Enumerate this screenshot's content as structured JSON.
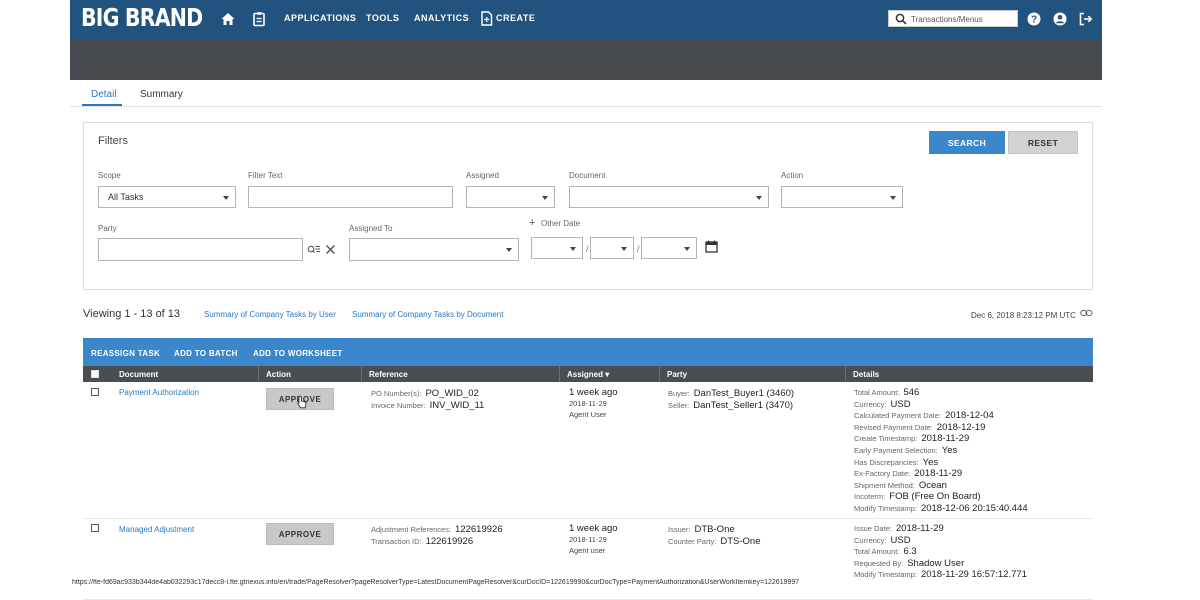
{
  "nav": {
    "brand": "BIG BRAND",
    "links": [
      "APPLICATIONS",
      "TOOLS",
      "ANALYTICS",
      "CREATE"
    ],
    "search_placeholder": "Transactions/Menus"
  },
  "tabs": [
    "Detail",
    "Summary"
  ],
  "filters": {
    "title": "Filters",
    "search_label": "SEARCH",
    "reset_label": "RESET",
    "scope_label": "Scope",
    "scope_value": "All Tasks",
    "filter_text_label": "Filter Text",
    "assigned_label": "Assigned",
    "document_label": "Document",
    "action_label": "Action",
    "party_label": "Party",
    "assigned_to_label": "Assigned To",
    "other_date_label": "Other Date"
  },
  "viewing": {
    "text": "Viewing 1 - 13 of 13",
    "link_by_user": "Summary of Company Tasks by User",
    "link_by_document": "Summary of Company Tasks by Document",
    "timestamp": "Dec 6, 2018 8:23:12 PM UTC"
  },
  "actions": [
    "REASSIGN TASK",
    "ADD TO BATCH",
    "ADD TO WORKSHEET"
  ],
  "table": {
    "headers": [
      "Document",
      "Action",
      "Reference",
      "Assigned ▾",
      "Party",
      "Details"
    ],
    "approve_label": "APPROVE",
    "rows": [
      {
        "document": "Payment Authorization",
        "reference": [
          {
            "label": "PO Number(s):",
            "value": "PO_WID_02"
          },
          {
            "label": "Invoice Number:",
            "value": "INV_WID_11"
          }
        ],
        "assigned": "1 week ago",
        "assigned_date": "2018-11-29",
        "assigned_user": "Agent User",
        "party": [
          {
            "label": "Buyer:",
            "value": "DanTest_Buyer1 (3460)"
          },
          {
            "label": "Seller:",
            "value": "DanTest_Seller1 (3470)"
          }
        ],
        "details": [
          {
            "label": "Total Amount:",
            "value": "546"
          },
          {
            "label": "Currency:",
            "value": "USD"
          },
          {
            "label": "Calculated Payment Date:",
            "value": "2018-12-04"
          },
          {
            "label": "Revised Payment Date:",
            "value": "2018-12-19"
          },
          {
            "label": "Create Timestamp:",
            "value": "2018-11-29"
          },
          {
            "label": "Early Payment Selection:",
            "value": "Yes"
          },
          {
            "label": "Has Discrepancies:",
            "value": "Yes"
          },
          {
            "label": "Ex-Factory Date:",
            "value": "2018-11-29"
          },
          {
            "label": "Shipment Method:",
            "value": "Ocean"
          },
          {
            "label": "Incoterm:",
            "value": "FOB (Free On Board)"
          },
          {
            "label": "Modify Timestamp:",
            "value": "2018-12-06 20:15:40.444"
          }
        ]
      },
      {
        "document": "Managed Adjustment",
        "reference": [
          {
            "label": "Adjustment References:",
            "value": "122619926"
          },
          {
            "label": "Transaction ID:",
            "value": "122619926"
          }
        ],
        "assigned": "1 week ago",
        "assigned_date": "2018-11-29",
        "assigned_user": "Agent user",
        "party": [
          {
            "label": "Issuer:",
            "value": "DTB-One"
          },
          {
            "label": "Counter Party:",
            "value": "DTS-One"
          }
        ],
        "details": [
          {
            "label": "Issue Date:",
            "value": "2018-11-29"
          },
          {
            "label": "Currency:",
            "value": "USD"
          },
          {
            "label": "Total Amount:",
            "value": "6.3"
          },
          {
            "label": "Requested By:",
            "value": "Shadow User"
          },
          {
            "label": "Modify Timestamp:",
            "value": "2018-11-29 16:57:12.771"
          }
        ]
      }
    ]
  },
  "status_url": "https://fte-fd69ac933b344de4ab032293c17decc8-l.fte.gtnexus.info/en/trade/PageResolver?pageResolverType=LatestDocumentPageResolver&curDocID=122619990&curDocType=PaymentAuthorization&UserWorkItemkey=122619997"
}
